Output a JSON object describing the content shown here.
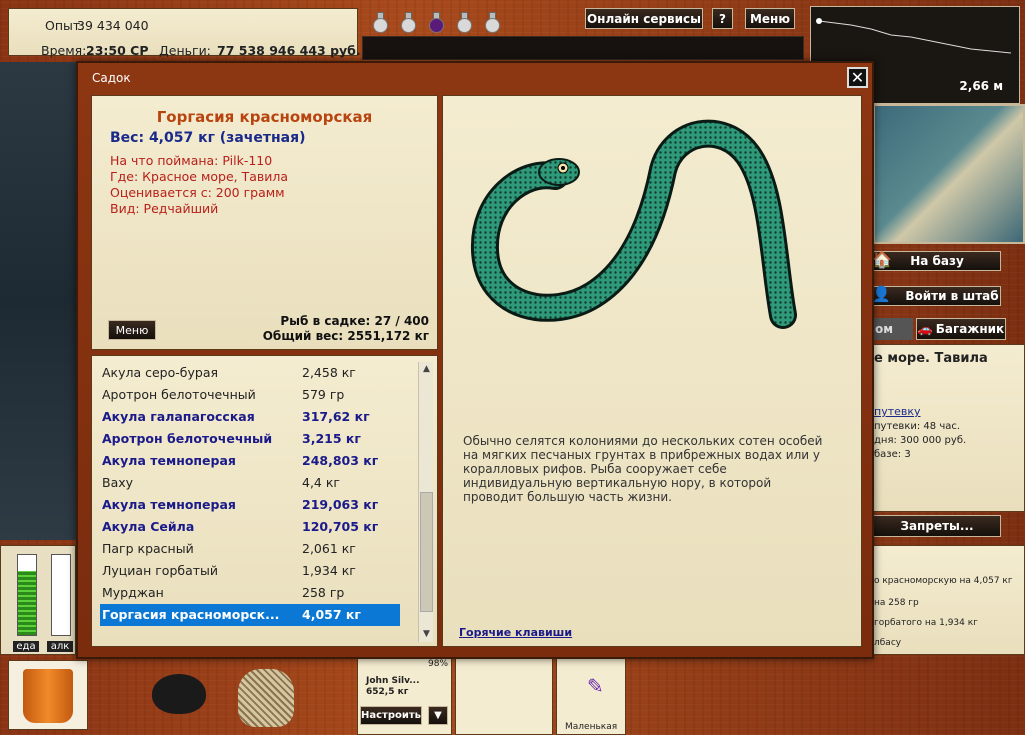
{
  "top_info": {
    "experience_label": "Опыт:",
    "experience_value": "39 434 040",
    "time_label": "Время:",
    "time_value": "23:50 СР",
    "money_label": "Деньги:",
    "money_value": "77 538 946 443 руб."
  },
  "top_menu": {
    "online_services": "Онлайн сервисы",
    "help": "?",
    "menu": "Меню"
  },
  "depth_readout": "2,66 м",
  "side_buttons": {
    "to_base": "На базу",
    "to_hq": "Войти в штаб",
    "partial_btn": "ом",
    "trunk": "Багажник",
    "bans": "Запреты..."
  },
  "right_panel": {
    "location": "е море. Тавила",
    "link": "путевку",
    "line1": "путевки: 48 час.",
    "line2": "дня: 300 000 руб.",
    "line3": "базе: 3"
  },
  "right_log": [
    "о красноморскую на 4,057 кг",
    "на 258 гр",
    "горбатого на 1,934 кг",
    "лбасу"
  ],
  "bars": {
    "food_label": "еда",
    "alcohol_label": "алк",
    "food_level": 0.8,
    "alcohol_level": 0
  },
  "tackle": {
    "owner": "John Silv...",
    "weight": "652,5 кг",
    "percent": "98%",
    "configure": "Настроить",
    "dropdown": "▼",
    "size_label": "Маленькая"
  },
  "sadok": {
    "title": "Садок",
    "close": "✕",
    "fish_name": "Горгасия красноморская",
    "fish_weight": "Вес: 4,057 кг (зачетная)",
    "caught_on": "На что поймана: Pilk-110",
    "where": "Где: Красное море, Тавила",
    "rated_from": "Оценивается с: 200 грамм",
    "kind": "Вид: Редчайший",
    "menu_btn": "Меню",
    "fish_count": "Рыб в садке: 27 / 400",
    "total_weight": "Общий вес: 2551,172 кг",
    "description": "Обычно селятся колониями до нескольких сотен особей на мягких песчаных грунтах в прибрежных водах или у коралловых рифов. Рыба сооружает себе индивидуальную вертикальную нору, в которой проводит большую часть жизни.",
    "hotkeys": "Горячие клавиши",
    "fish_list": [
      {
        "name": "Акула серо-бурая",
        "weight": "2,458 кг",
        "bold": false
      },
      {
        "name": "Аротрон белоточечный",
        "weight": "579 гр",
        "bold": false
      },
      {
        "name": "Акула галапагосская",
        "weight": "317,62 кг",
        "bold": true
      },
      {
        "name": "Аротрон белоточечный",
        "weight": "3,215 кг",
        "bold": true
      },
      {
        "name": "Акула темноперая",
        "weight": "248,803 кг",
        "bold": true
      },
      {
        "name": "Ваху",
        "weight": "4,4 кг",
        "bold": false
      },
      {
        "name": "Акула темноперая",
        "weight": "219,063 кг",
        "bold": true
      },
      {
        "name": "Акула Сейла",
        "weight": "120,705 кг",
        "bold": true
      },
      {
        "name": "Пагр красный",
        "weight": "2,061 кг",
        "bold": false
      },
      {
        "name": "Луциан горбатый",
        "weight": "1,934 кг",
        "bold": false
      },
      {
        "name": "Мурджан",
        "weight": "258 гр",
        "bold": false
      },
      {
        "name": "Горгасия красноморск...",
        "weight": "4,057 кг",
        "bold": false,
        "selected": true
      }
    ]
  },
  "icons": [
    "potion-icon",
    "close-icon",
    "house-icon",
    "person-icon",
    "car-icon",
    "bucket-icon",
    "pot-icon",
    "net-icon",
    "eel-image"
  ]
}
